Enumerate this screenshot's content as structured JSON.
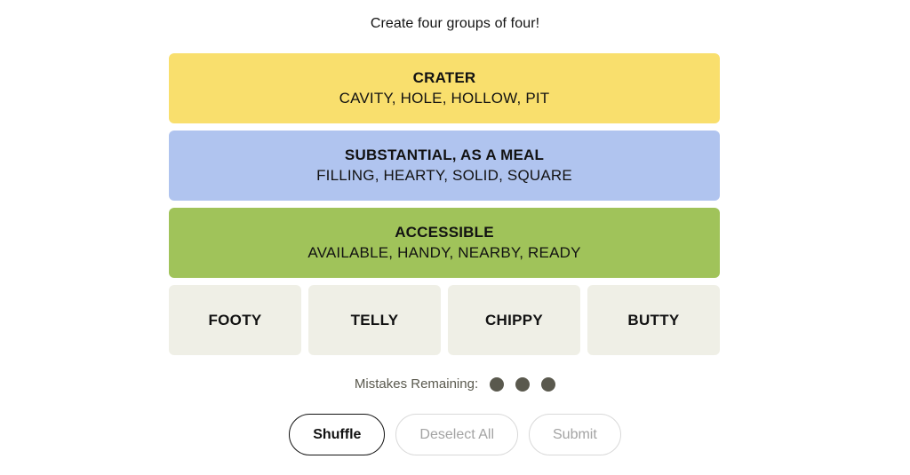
{
  "game": {
    "instruction": "Create four groups of four!",
    "solved_groups": [
      {
        "title": "CRATER",
        "members": "CAVITY, HOLE, HOLLOW, PIT",
        "color": "#f9df6d",
        "difficulty": "yellow"
      },
      {
        "title": "SUBSTANTIAL, AS A MEAL",
        "members": "FILLING, HEARTY, SOLID, SQUARE",
        "color": "#b0c4ef",
        "difficulty": "blue"
      },
      {
        "title": "ACCESSIBLE",
        "members": "AVAILABLE, HANDY, NEARBY, READY",
        "color": "#a0c35a",
        "difficulty": "green"
      }
    ],
    "tiles": [
      {
        "label": "FOOTY"
      },
      {
        "label": "TELLY"
      },
      {
        "label": "CHIPPY"
      },
      {
        "label": "BUTTY"
      }
    ],
    "mistakes": {
      "label": "Mistakes Remaining:",
      "remaining": 3,
      "dot_color": "#5a594e"
    },
    "controls": [
      {
        "label": "Shuffle",
        "state": "enabled"
      },
      {
        "label": "Deselect All",
        "state": "disabled"
      },
      {
        "label": "Submit",
        "state": "disabled"
      }
    ],
    "colors": {
      "tile_background": "#efefe6",
      "text": "#121212",
      "page_background": "#ffffff"
    }
  }
}
